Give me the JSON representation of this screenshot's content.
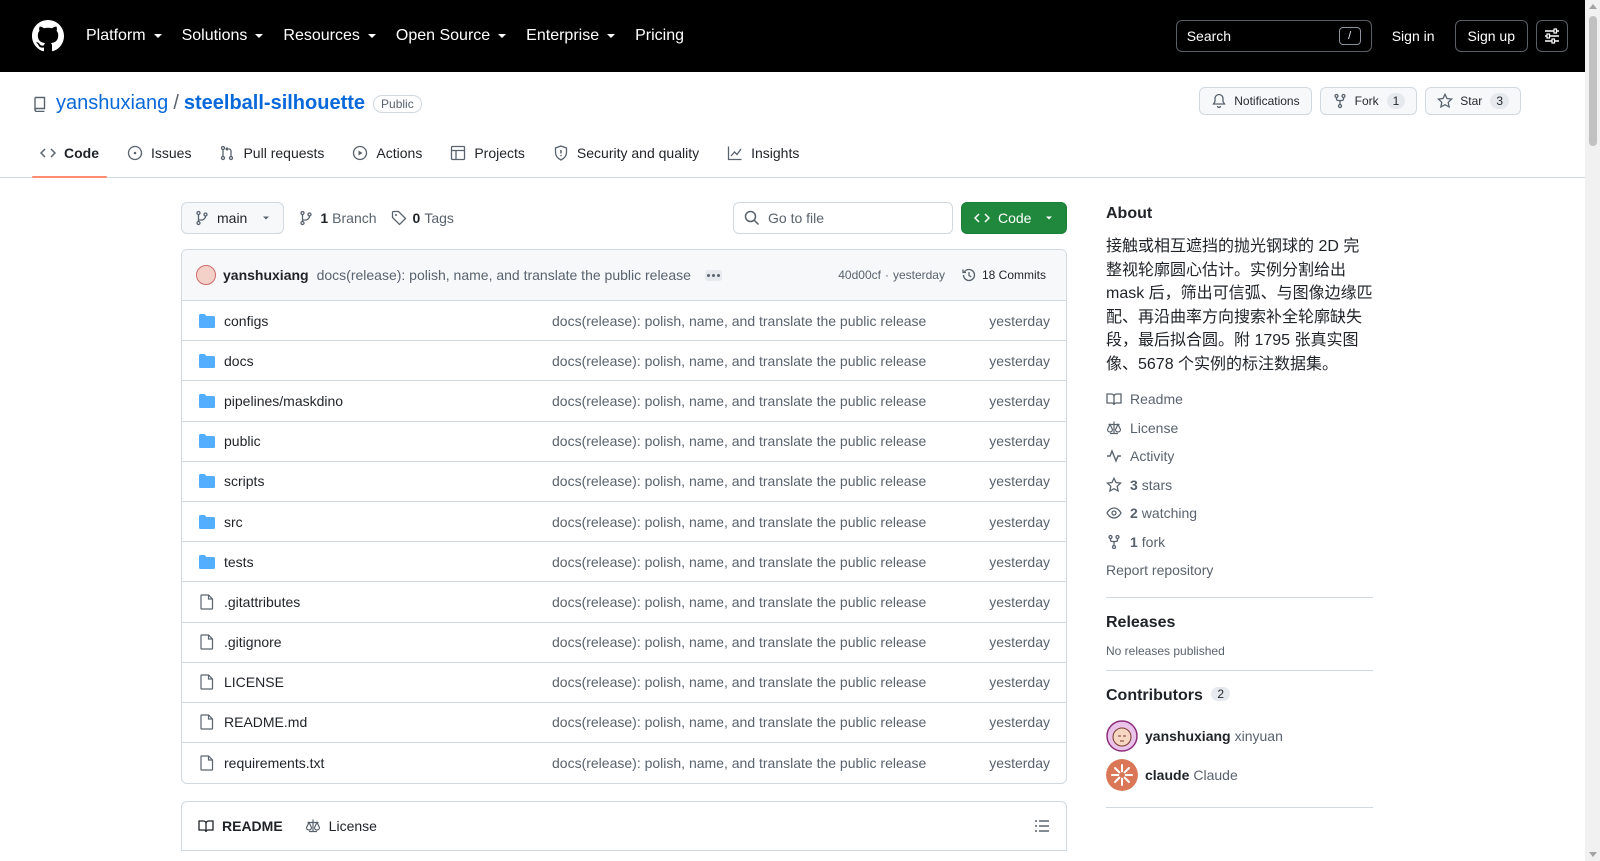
{
  "header": {
    "nav": [
      {
        "label": "Platform",
        "dropdown": true
      },
      {
        "label": "Solutions",
        "dropdown": true
      },
      {
        "label": "Resources",
        "dropdown": true
      },
      {
        "label": "Open Source",
        "dropdown": true
      },
      {
        "label": "Enterprise",
        "dropdown": true
      },
      {
        "label": "Pricing",
        "dropdown": false
      }
    ],
    "search_label": "Search",
    "search_shortcut": "/",
    "sign_in": "Sign in",
    "sign_up": "Sign up"
  },
  "repo": {
    "owner": "yanshuxiang",
    "separator": "/",
    "name": "steelball-silhouette",
    "visibility": "Public",
    "notifications_label": "Notifications",
    "fork_label": "Fork",
    "fork_count": "1",
    "star_label": "Star",
    "star_count": "3",
    "tabs": [
      "Code",
      "Issues",
      "Pull requests",
      "Actions",
      "Projects",
      "Security and quality",
      "Insights"
    ],
    "active_tab": "Code"
  },
  "toolbar": {
    "branch": "main",
    "branch_count": "1",
    "branch_label": "Branch",
    "tag_count": "0",
    "tag_label": "Tags",
    "goto_placeholder": "Go to file",
    "code_button": "Code"
  },
  "latest_commit": {
    "author": "yanshuxiang",
    "message": "docs(release): polish, name, and translate the public release",
    "sha": "40d00cf",
    "separator": "·",
    "when": "yesterday",
    "commits_label": "18 Commits"
  },
  "files": [
    {
      "name": "configs",
      "type": "dir",
      "message": "docs(release): polish, name, and translate the public release",
      "when": "yesterday"
    },
    {
      "name": "docs",
      "type": "dir",
      "message": "docs(release): polish, name, and translate the public release",
      "when": "yesterday"
    },
    {
      "name": "pipelines/maskdino",
      "type": "dir",
      "message": "docs(release): polish, name, and translate the public release",
      "when": "yesterday"
    },
    {
      "name": "public",
      "type": "dir",
      "message": "docs(release): polish, name, and translate the public release",
      "when": "yesterday"
    },
    {
      "name": "scripts",
      "type": "dir",
      "message": "docs(release): polish, name, and translate the public release",
      "when": "yesterday"
    },
    {
      "name": "src",
      "type": "dir",
      "message": "docs(release): polish, name, and translate the public release",
      "when": "yesterday"
    },
    {
      "name": "tests",
      "type": "dir",
      "message": "docs(release): polish, name, and translate the public release",
      "when": "yesterday"
    },
    {
      "name": ".gitattributes",
      "type": "file",
      "message": "docs(release): polish, name, and translate the public release",
      "when": "yesterday"
    },
    {
      "name": ".gitignore",
      "type": "file",
      "message": "docs(release): polish, name, and translate the public release",
      "when": "yesterday"
    },
    {
      "name": "LICENSE",
      "type": "file",
      "message": "docs(release): polish, name, and translate the public release",
      "when": "yesterday"
    },
    {
      "name": "README.md",
      "type": "file",
      "message": "docs(release): polish, name, and translate the public release",
      "when": "yesterday"
    },
    {
      "name": "requirements.txt",
      "type": "file",
      "message": "docs(release): polish, name, and translate the public release",
      "when": "yesterday"
    }
  ],
  "readme_tabs": [
    "README",
    "License"
  ],
  "about": {
    "title": "About",
    "description": "接触或相互遮挡的抛光钢球的 2D 完整视轮廓圆心估计。实例分割给出 mask 后，筛出可信弧、与图像边缘匹配、再沿曲率方向搜索补全轮廓缺失段，最后拟合圆。附 1795 张真实图像、5678 个实例的标注数据集。",
    "readme": "Readme",
    "license": "License",
    "activity": "Activity",
    "stars_count": "3",
    "stars_label": "stars",
    "watching_count": "2",
    "watching_label": "watching",
    "fork_count": "1",
    "fork_label": "fork",
    "report": "Report repository"
  },
  "releases": {
    "title": "Releases",
    "empty": "No releases published"
  },
  "contributors": {
    "title": "Contributors",
    "count": "2",
    "people": [
      {
        "login": "yanshuxiang",
        "name": "xinyuan"
      },
      {
        "login": "claude",
        "name": "Claude"
      }
    ]
  },
  "colors": {
    "header_bg": "#000000",
    "link": "#0969da",
    "code_button": "#1f883d",
    "active_tab_underline": "#fd8c73",
    "folder": "#54aeff"
  }
}
